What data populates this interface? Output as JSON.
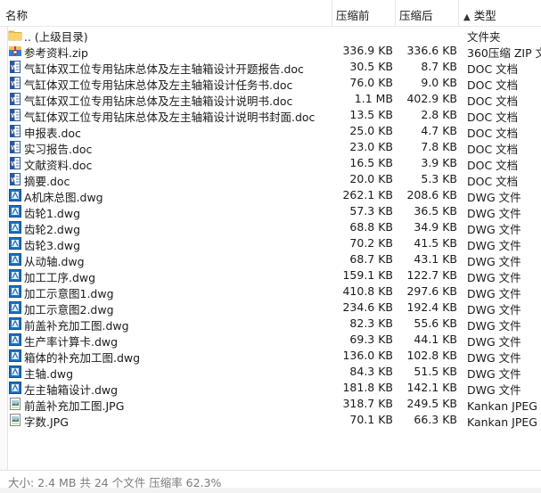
{
  "header": {
    "name": "名称",
    "packed": "压缩前",
    "size": "压缩后",
    "type": "类型",
    "sort_icon": "▲"
  },
  "rows": [
    {
      "icon": "folder-icon",
      "name": ".. (上级目录)",
      "packed": "",
      "size": "",
      "type": "文件夹"
    },
    {
      "icon": "zip-icon",
      "name": "参考资料.zip",
      "packed": "336.9 KB",
      "size": "336.6 KB",
      "type": "360压缩 ZIP 文"
    },
    {
      "icon": "doc-icon",
      "name": "气缸体双工位专用钻床总体及左主轴箱设计开题报告.doc",
      "packed": "30.5 KB",
      "size": "8.7 KB",
      "type": "DOC 文档"
    },
    {
      "icon": "doc-icon",
      "name": "气缸体双工位专用钻床总体及左主轴箱设计任务书.doc",
      "packed": "76.0 KB",
      "size": "9.0 KB",
      "type": "DOC 文档"
    },
    {
      "icon": "doc-icon",
      "name": "气缸体双工位专用钻床总体及左主轴箱设计说明书.doc",
      "packed": "1.1 MB",
      "size": "402.9 KB",
      "type": "DOC 文档"
    },
    {
      "icon": "doc-icon",
      "name": "气缸体双工位专用钻床总体及左主轴箱设计说明书封面.doc",
      "packed": "13.5 KB",
      "size": "2.8 KB",
      "type": "DOC 文档"
    },
    {
      "icon": "doc-icon",
      "name": "申报表.doc",
      "packed": "25.0 KB",
      "size": "4.7 KB",
      "type": "DOC 文档"
    },
    {
      "icon": "doc-icon",
      "name": "实习报告.doc",
      "packed": "23.0 KB",
      "size": "7.8 KB",
      "type": "DOC 文档"
    },
    {
      "icon": "doc-icon",
      "name": "文献资料.doc",
      "packed": "16.5 KB",
      "size": "3.9 KB",
      "type": "DOC 文档"
    },
    {
      "icon": "doc-icon",
      "name": "摘要.doc",
      "packed": "20.0 KB",
      "size": "5.3 KB",
      "type": "DOC 文档"
    },
    {
      "icon": "dwg-icon",
      "name": "A机床总图.dwg",
      "packed": "262.1 KB",
      "size": "208.6 KB",
      "type": "DWG 文件"
    },
    {
      "icon": "dwg-icon",
      "name": "齿轮1.dwg",
      "packed": "57.3 KB",
      "size": "36.5 KB",
      "type": "DWG 文件"
    },
    {
      "icon": "dwg-icon",
      "name": "齿轮2.dwg",
      "packed": "68.8 KB",
      "size": "34.9 KB",
      "type": "DWG 文件"
    },
    {
      "icon": "dwg-icon",
      "name": "齿轮3.dwg",
      "packed": "70.2 KB",
      "size": "41.5 KB",
      "type": "DWG 文件"
    },
    {
      "icon": "dwg-icon",
      "name": "从动轴.dwg",
      "packed": "68.7 KB",
      "size": "43.1 KB",
      "type": "DWG 文件"
    },
    {
      "icon": "dwg-icon",
      "name": "加工工序.dwg",
      "packed": "159.1 KB",
      "size": "122.7 KB",
      "type": "DWG 文件"
    },
    {
      "icon": "dwg-icon",
      "name": "加工示意图1.dwg",
      "packed": "410.8 KB",
      "size": "297.6 KB",
      "type": "DWG 文件"
    },
    {
      "icon": "dwg-icon",
      "name": "加工示意图2.dwg",
      "packed": "234.6 KB",
      "size": "192.4 KB",
      "type": "DWG 文件"
    },
    {
      "icon": "dwg-icon",
      "name": "前盖补充加工图.dwg",
      "packed": "82.3 KB",
      "size": "55.6 KB",
      "type": "DWG 文件"
    },
    {
      "icon": "dwg-icon",
      "name": "生产率计算卡.dwg",
      "packed": "69.3 KB",
      "size": "44.1 KB",
      "type": "DWG 文件"
    },
    {
      "icon": "dwg-icon",
      "name": "箱体的补充加工图.dwg",
      "packed": "136.0 KB",
      "size": "102.8 KB",
      "type": "DWG 文件"
    },
    {
      "icon": "dwg-icon",
      "name": "主轴.dwg",
      "packed": "84.3 KB",
      "size": "51.5 KB",
      "type": "DWG 文件"
    },
    {
      "icon": "dwg-icon",
      "name": "左主轴箱设计.dwg",
      "packed": "181.8 KB",
      "size": "142.1 KB",
      "type": "DWG 文件"
    },
    {
      "icon": "jpg-icon",
      "name": "前盖补充加工图.JPG",
      "packed": "318.7 KB",
      "size": "249.5 KB",
      "type": "Kankan JPEG 图"
    },
    {
      "icon": "jpg-icon",
      "name": "字数.JPG",
      "packed": "70.1 KB",
      "size": "66.3 KB",
      "type": "Kankan JPEG 图"
    }
  ],
  "status": {
    "text": "大小: 2.4 MB 共 24 个文件 压缩率 62.3%"
  },
  "colors": {
    "folder": "#f0c24a",
    "doc_blue": "#2b5797",
    "dwg_blue": "#1e6fc2",
    "status_text": "#7a7a7a"
  }
}
